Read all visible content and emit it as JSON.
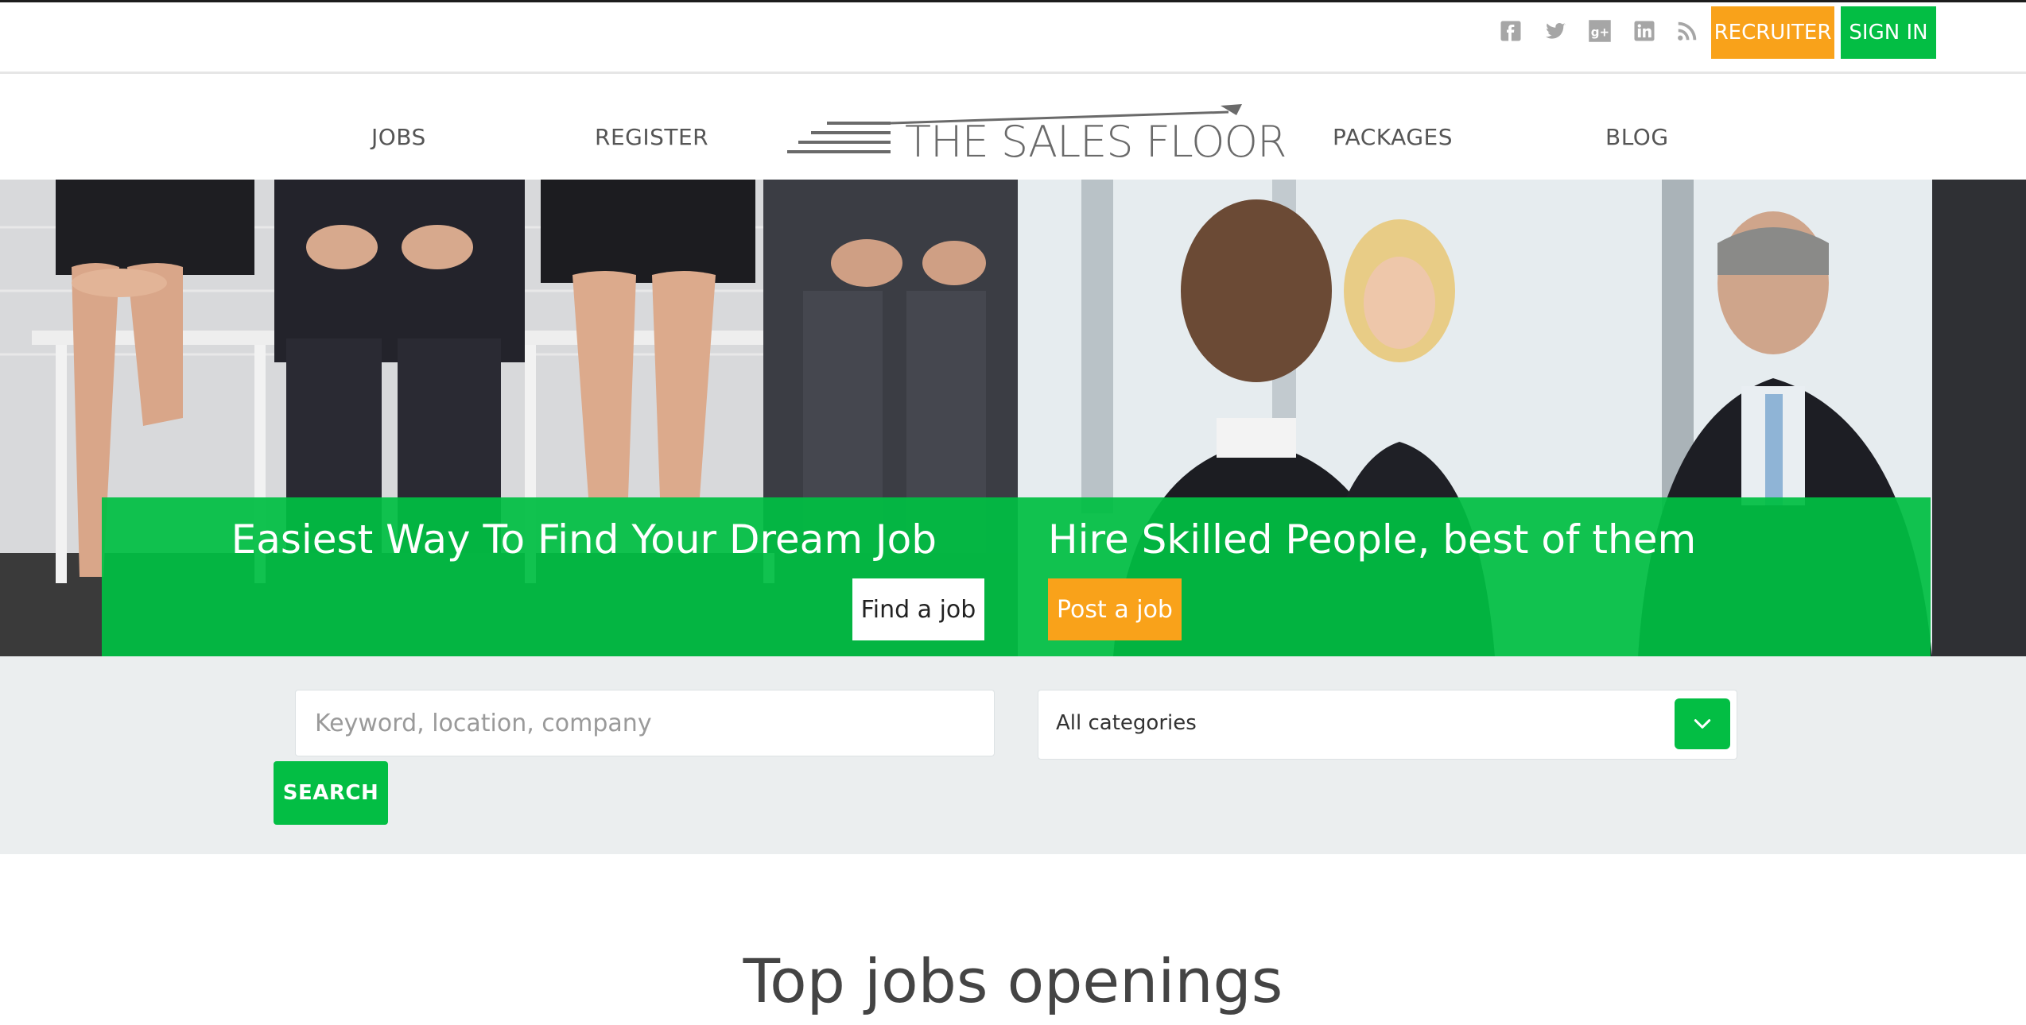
{
  "colors": {
    "green": "#03be44",
    "orange": "#f9a21a",
    "nav_text": "#555555"
  },
  "topbar": {
    "social_icons": [
      "facebook-icon",
      "twitter-icon",
      "google-plus-icon",
      "linkedin-icon",
      "rss-icon"
    ],
    "recruiter_label": "RECRUITER",
    "signin_label": "SIGN IN"
  },
  "nav": {
    "jobs": "JOBS",
    "register": "REGISTER",
    "logo_text": "THE SALES FLOOR",
    "packages": "PACKAGES",
    "blog": "BLOG"
  },
  "hero": {
    "left_title": "Easiest Way To Find Your Dream Job",
    "find_button": "Find a job",
    "right_title": "Hire Skilled People, best of them",
    "post_button": "Post a job"
  },
  "search": {
    "keyword_placeholder": "Keyword, location, company",
    "keyword_value": "",
    "category_value": "All categories",
    "button_label": "SEARCH"
  },
  "section": {
    "title": "Top jobs openings"
  }
}
